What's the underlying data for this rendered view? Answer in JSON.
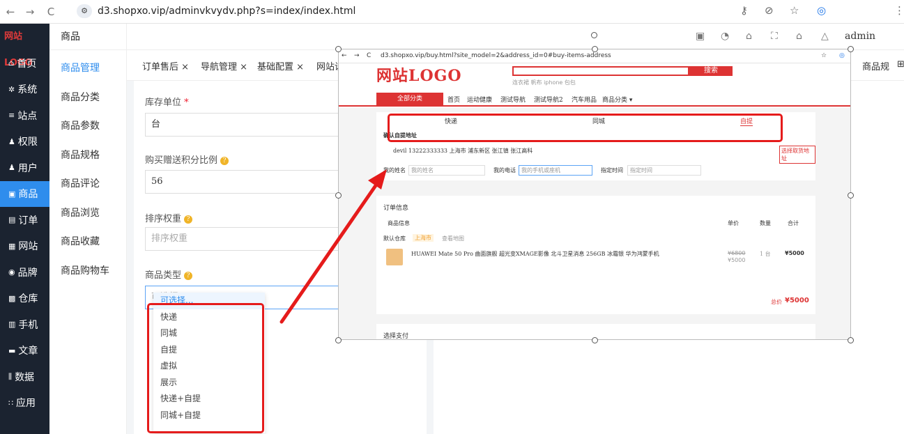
{
  "browser": {
    "url": "d3.shopxo.vip/adminvkvydv.php?s=index/index.html",
    "back_icon": "←",
    "forward_icon": "→",
    "reload_icon": "C",
    "menu_icon": "⋮"
  },
  "sidebar": {
    "logo": "网站LOGO",
    "items": [
      {
        "label": "首页",
        "icon": "home-icon",
        "glyph": "⌂"
      },
      {
        "label": "系统",
        "icon": "gear-icon",
        "glyph": "✲"
      },
      {
        "label": "站点",
        "icon": "sliders-icon",
        "glyph": "≡"
      },
      {
        "label": "权限",
        "icon": "user-key-icon",
        "glyph": "♟"
      },
      {
        "label": "用户",
        "icon": "user-icon",
        "glyph": "♟"
      },
      {
        "label": "商品",
        "icon": "goods-icon",
        "glyph": "▣",
        "active": true
      },
      {
        "label": "订单",
        "icon": "order-icon",
        "glyph": "▤"
      },
      {
        "label": "网站",
        "icon": "website-icon",
        "glyph": "▦"
      },
      {
        "label": "品牌",
        "icon": "brand-icon",
        "glyph": "◉"
      },
      {
        "label": "仓库",
        "icon": "warehouse-icon",
        "glyph": "▩"
      },
      {
        "label": "手机",
        "icon": "mobile-icon",
        "glyph": "▥"
      },
      {
        "label": "文章",
        "icon": "article-icon",
        "glyph": "▬"
      },
      {
        "label": "数据",
        "icon": "chart-icon",
        "glyph": "⫼"
      },
      {
        "label": "应用",
        "icon": "apps-icon",
        "glyph": "∷"
      }
    ]
  },
  "submenu": {
    "title": "商品",
    "items": [
      "商品管理",
      "商品分类",
      "商品参数",
      "商品规格",
      "商品评论",
      "商品浏览",
      "商品收藏",
      "商品购物车"
    ]
  },
  "topbar": {
    "user": "admin"
  },
  "tabs": [
    "订单售后 ×",
    "导航管理 ×",
    "基础配置 ×",
    "网站设",
    "商品规"
  ],
  "form": {
    "stock_unit_label": "库存单位",
    "required_mark": "*",
    "stock_unit_value": "台",
    "points_label": "购买赠送积分比例",
    "points_value": "56",
    "weight_label": "排序权重",
    "weight_placeholder": "排序权重",
    "type_label": "商品类型",
    "type_placeholder": "可选择...",
    "options": [
      "可选择...",
      "快递",
      "同城",
      "自提",
      "虚拟",
      "展示",
      "快递+自提",
      "同城+自提"
    ]
  },
  "screenshot": {
    "url": "d3.shopxo.vip/buy.html?site_model=2&address_id=0#buy-items-address",
    "logo": "网站LOGO",
    "search_btn": "搜索",
    "search_hints": "连衣裙 帆布 iphone 包包",
    "nav_all": "全部分类",
    "nav": [
      "首页",
      "运动健康",
      "测试导航",
      "测试导航2",
      "汽车用品",
      "商品分类 ▾"
    ],
    "ship_tabs": [
      "快递",
      "同城",
      "自提"
    ],
    "address_title": "确认自提地址",
    "address": "devil 13222333333 上海市 浦东新区 张江镇 张江高科",
    "choose_address": "选择取货地址",
    "name_label": "我的姓名",
    "name_ph": "我的姓名",
    "phone_label": "我的电话",
    "phone_ph": "我的手机或座机",
    "time_label": "指定时间",
    "time_ph": "指定时间",
    "order_title": "订单信息",
    "col_goods": "商品信息",
    "col_price": "单价",
    "col_qty": "数量",
    "col_total": "合计",
    "warehouse": "默认仓库",
    "warehouse_city": "上海市",
    "map_link": "查看地图",
    "product": "HUAWEI Mate 50 Pro 曲面旗舰 超光变XMAGE影像 北斗卫星消息 256GB 冰霜银 华为鸿蒙手机",
    "old_price": "¥6800",
    "price": "¥5000",
    "qty": "1 台",
    "line_total": "¥5000",
    "total_label": "总价",
    "total": "¥5000",
    "pay_title": "选择支付"
  },
  "colors": {
    "accent": "#2f8ded",
    "sidebar_bg": "#1b2330",
    "highlight": "#e51b1b",
    "shop_red": "#d33"
  }
}
